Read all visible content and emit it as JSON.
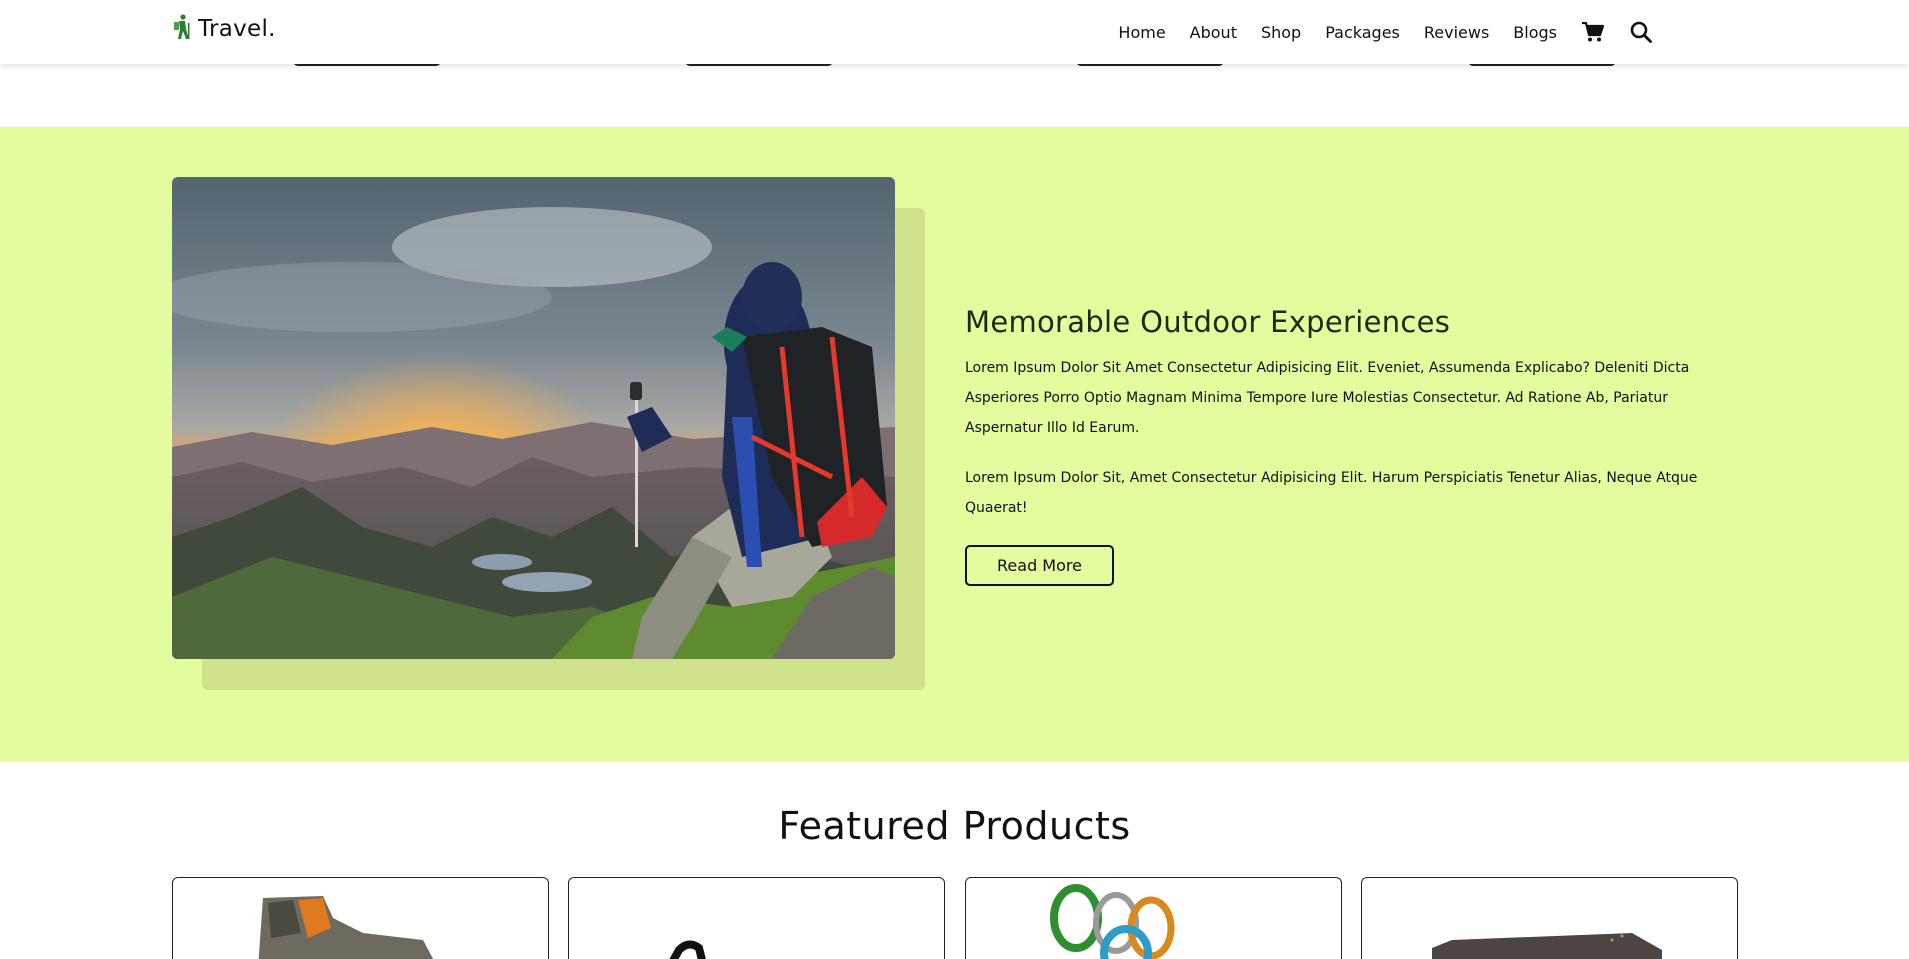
{
  "header": {
    "logo_text": "Travel.",
    "nav": [
      "Home",
      "About",
      "Shop",
      "Packages",
      "Reviews",
      "Blogs"
    ],
    "icons": [
      "cart-icon",
      "search-icon"
    ]
  },
  "about": {
    "title": "Memorable Outdoor Experiences",
    "paragraph1": "Lorem Ipsum Dolor Sit Amet Consectetur Adipisicing Elit. Eveniet, Assumenda Explicabo? Deleniti Dicta Asperiores Porro Optio Magnam Minima Tempore Iure Molestias Consectetur. Ad Ratione Ab, Pariatur Aspernatur Illo Id Earum.",
    "paragraph2": "Lorem Ipsum Dolor Sit, Amet Consectetur Adipisicing Elit. Harum Perspiciatis Tenetur Alias, Neque Atque Quaerat!",
    "button_label": "Read More",
    "bg_color": "#e3fc9e"
  },
  "featured": {
    "title": "Featured Products"
  },
  "colors": {
    "accent": "#e3fc9e",
    "text": "#111111"
  }
}
